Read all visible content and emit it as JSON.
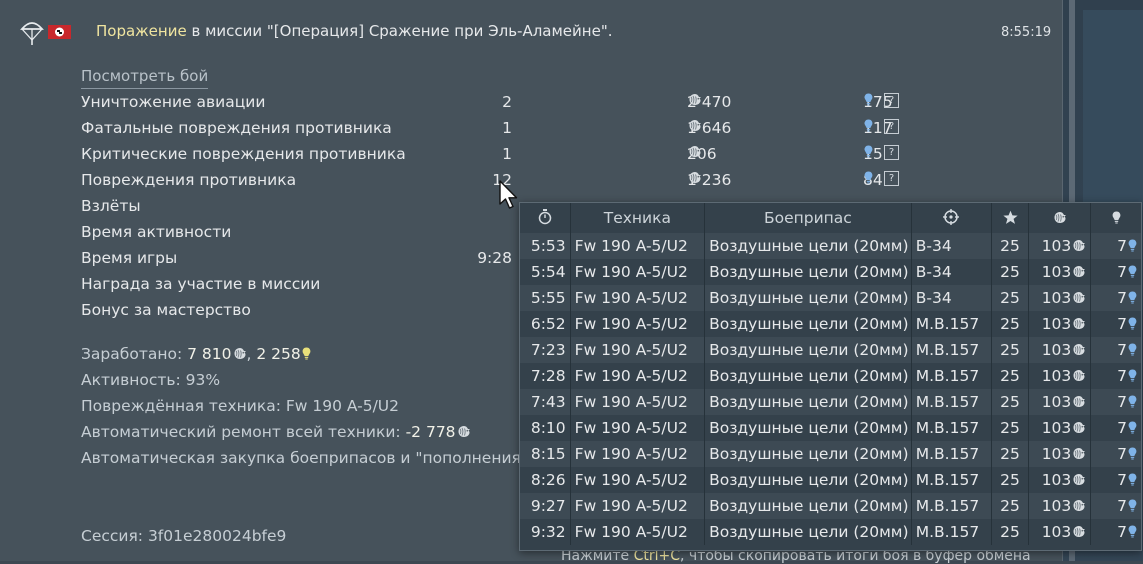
{
  "header": {
    "title_prefix": "Поражение",
    "title_rest": " в миссии \"[Операция] Сражение при Эль-Аламейне\".",
    "time": "8:55:19"
  },
  "view_battle_link": "Посмотреть бой",
  "stats": [
    {
      "label": "Уничтожение авиации",
      "count": "2",
      "silver": "2 470",
      "rp": "175",
      "help": "?"
    },
    {
      "label": "Фатальные повреждения противника",
      "count": "1",
      "silver": "1 646",
      "rp": "117",
      "help": "?"
    },
    {
      "label": "Критические повреждения противника",
      "count": "1",
      "silver": "206",
      "rp": "15",
      "help": "?"
    },
    {
      "label": "Повреждения противника",
      "count": "12",
      "silver": "1 236",
      "rp": "84",
      "help": "?"
    },
    {
      "label": "Взлёты",
      "count": "",
      "silver": "",
      "rp": "",
      "help": ""
    },
    {
      "label": "Время активности",
      "count": "",
      "silver": "",
      "rp": "",
      "help": ""
    },
    {
      "label": "Время игры",
      "count": "9:28",
      "silver": "",
      "rp": "",
      "help": ""
    },
    {
      "label": "Награда за участие в миссии",
      "count": "",
      "silver": "",
      "rp": "",
      "help": ""
    },
    {
      "label": "Бонус за мастерство",
      "count": "",
      "silver": "",
      "rp": "",
      "help": ""
    }
  ],
  "summary": {
    "earned_label": "Заработано:",
    "earned_silver": "7 810",
    "earned_sep": ",",
    "earned_rp": "2 258",
    "activity": "Активность: 93%",
    "damaged_vehicle": "Повреждённая техника: Fw 190 A-5/U2",
    "repair_label": "Автоматический ремонт всей техники:",
    "repair_value": "-2 778",
    "ammo": "Автоматическая закупка боеприпасов и \"пополнения э",
    "session": "Сессия: 3f01e280024bfe9"
  },
  "footer": {
    "hint_prefix": "Нажмите",
    "hint_key": "Ctrl+C",
    "hint_rest": ", чтобы скопировать итоги боя в буфер обмена"
  },
  "tooltip": {
    "headers": {
      "vehicle": "Техника",
      "ammo": "Боеприпас"
    },
    "rows": [
      {
        "time": "5:53",
        "vehicle": "Fw 190 A-5/U2",
        "ammo": "Воздушные цели (20мм)",
        "target": "B-34",
        "score": "25",
        "silver": "103",
        "rp": "7"
      },
      {
        "time": "5:54",
        "vehicle": "Fw 190 A-5/U2",
        "ammo": "Воздушные цели (20мм)",
        "target": "B-34",
        "score": "25",
        "silver": "103",
        "rp": "7"
      },
      {
        "time": "5:55",
        "vehicle": "Fw 190 A-5/U2",
        "ammo": "Воздушные цели (20мм)",
        "target": "B-34",
        "score": "25",
        "silver": "103",
        "rp": "7"
      },
      {
        "time": "6:52",
        "vehicle": "Fw 190 A-5/U2",
        "ammo": "Воздушные цели (20мм)",
        "target": "M.B.157",
        "score": "25",
        "silver": "103",
        "rp": "7"
      },
      {
        "time": "7:23",
        "vehicle": "Fw 190 A-5/U2",
        "ammo": "Воздушные цели (20мм)",
        "target": "M.B.157",
        "score": "25",
        "silver": "103",
        "rp": "7"
      },
      {
        "time": "7:28",
        "vehicle": "Fw 190 A-5/U2",
        "ammo": "Воздушные цели (20мм)",
        "target": "M.B.157",
        "score": "25",
        "silver": "103",
        "rp": "7"
      },
      {
        "time": "7:43",
        "vehicle": "Fw 190 A-5/U2",
        "ammo": "Воздушные цели (20мм)",
        "target": "M.B.157",
        "score": "25",
        "silver": "103",
        "rp": "7"
      },
      {
        "time": "8:10",
        "vehicle": "Fw 190 A-5/U2",
        "ammo": "Воздушные цели (20мм)",
        "target": "M.B.157",
        "score": "25",
        "silver": "103",
        "rp": "7"
      },
      {
        "time": "8:15",
        "vehicle": "Fw 190 A-5/U2",
        "ammo": "Воздушные цели (20мм)",
        "target": "M.B.157",
        "score": "25",
        "silver": "103",
        "rp": "7"
      },
      {
        "time": "8:26",
        "vehicle": "Fw 190 A-5/U2",
        "ammo": "Воздушные цели (20мм)",
        "target": "M.B.157",
        "score": "25",
        "silver": "103",
        "rp": "7"
      },
      {
        "time": "9:27",
        "vehicle": "Fw 190 A-5/U2",
        "ammo": "Воздушные цели (20мм)",
        "target": "M.B.157",
        "score": "25",
        "silver": "103",
        "rp": "7"
      },
      {
        "time": "9:32",
        "vehicle": "Fw 190 A-5/U2",
        "ammo": "Воздушные цели (20мм)",
        "target": "M.B.157",
        "score": "25",
        "silver": "103",
        "rp": "7"
      }
    ]
  },
  "colors": {
    "defeat": "#f0e5a0",
    "rp_icon": "#7fb3e8",
    "earned_rp_icon": "#e8e07a"
  },
  "icons": [
    "parachute-icon",
    "flag-icon",
    "help-icon",
    "silver-lion-icon",
    "research-point-icon",
    "clock-icon",
    "target-icon",
    "star-icon",
    "cursor-icon"
  ]
}
